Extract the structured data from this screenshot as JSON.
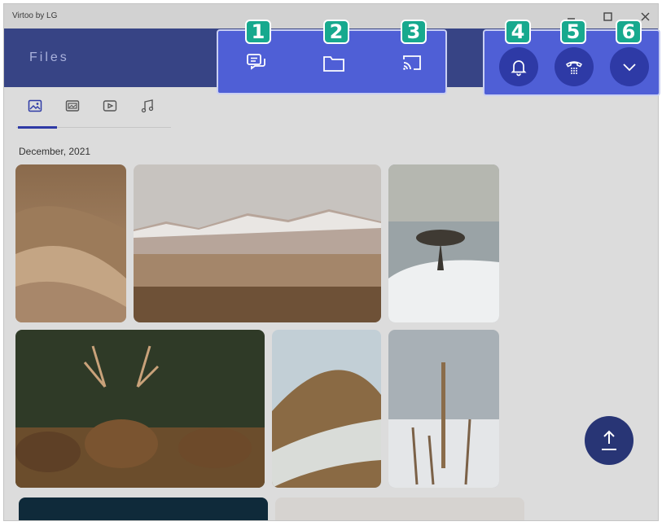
{
  "window": {
    "app_title": "Virtoo by LG",
    "controls": [
      "minimize-icon",
      "maximize-icon",
      "close-icon"
    ]
  },
  "header": {
    "title": "Files"
  },
  "toolbar": {
    "icons": [
      "chat-icon",
      "folder-icon",
      "cast-icon"
    ]
  },
  "actions": {
    "icons": [
      "bell-icon",
      "phone-icon",
      "chevron-down-icon"
    ]
  },
  "badges": [
    "1",
    "2",
    "3",
    "4",
    "5",
    "6"
  ],
  "media_tabs": [
    {
      "icon": "image-icon",
      "active": true
    },
    {
      "icon": "photo-album-icon",
      "active": false
    },
    {
      "icon": "video-icon",
      "active": false
    },
    {
      "icon": "music-icon",
      "active": false
    }
  ],
  "gallery": {
    "section_date": "December, 2021",
    "photos": [
      "desert-dunes-photo",
      "snowy-mountain-plains-photo",
      "lone-tree-snow-photo",
      "deer-herd-photo",
      "hill-road-photo",
      "frosted-grass-photo"
    ]
  },
  "upload_button": {
    "icon": "upload-arrow-icon"
  },
  "colors": {
    "header_bg": "#374485",
    "highlight_box": "#4f5fd6",
    "round_button": "#2e3aa6",
    "badge": "#17a98e",
    "fab": "#283575"
  }
}
